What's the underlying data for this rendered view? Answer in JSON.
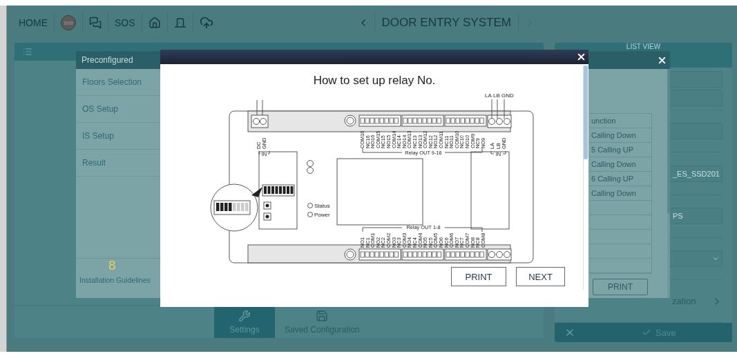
{
  "top_bar": {
    "home": "HOME",
    "emergency_badge": "999",
    "sos": "SOS",
    "title": "DOOR ENTRY SYSTEM"
  },
  "main_panel": {
    "tabs": [
      {
        "label": "Settings",
        "kind": "settings",
        "selected": true
      },
      {
        "label": "Saved Configuration",
        "kind": "saved",
        "selected": false
      }
    ]
  },
  "list_view": {
    "title": "LIST VIEW",
    "rows": [
      {
        "fields": [
          {
            "kind": "input"
          },
          {
            "kind": "input"
          }
        ]
      },
      {
        "fields": [
          {
            "kind": "input"
          }
        ]
      },
      {
        "fields": [
          {
            "kind": "input",
            "value": "_ES_SSD201"
          }
        ]
      },
      {
        "fields": [
          {
            "kind": "input",
            "value": "PS"
          }
        ]
      },
      {
        "fields": [
          {
            "kind": "select"
          }
        ]
      },
      {
        "fields": [
          {
            "kind": "link",
            "label": "zation"
          }
        ]
      }
    ],
    "save": "Save"
  },
  "preconfigured": {
    "title": "Preconfigured",
    "menu": [
      {
        "label": "Floors Selection"
      },
      {
        "label": "OS Setup"
      },
      {
        "label": "IS Setup"
      },
      {
        "label": "Result"
      }
    ],
    "guide_number": "8",
    "guide_label": "Installation Guidelines",
    "table_header": "unction",
    "table_rows": [
      "Calling Down",
      "5 Calling UP",
      "Calling Down",
      "6 Calling UP",
      "Calling Down"
    ],
    "print": "PRINT"
  },
  "relay_guide": {
    "title": "How to set up relay No.",
    "diagram": {
      "wire_labels": [
        "LA",
        "LB",
        "GND"
      ],
      "dc_labels": [
        "DC",
        "GND"
      ],
      "in_labels": [
        "IN",
        "IN"
      ],
      "bus_labels": [
        "LA",
        "LB",
        "GND"
      ],
      "top_relay_title": "Relay OUT 9-16",
      "top_pins": [
        "COM16",
        "NC16",
        "NO16",
        "COM15",
        "NC15",
        "NO15",
        "COM14",
        "NC14",
        "NO14",
        "COM13",
        "NC13",
        "NO13",
        "COM12",
        "NC12",
        "NO12",
        "COM11",
        "NC11",
        "NO11",
        "COM10",
        "NC10",
        "NO10",
        "COM9",
        "NC9",
        "NO9"
      ],
      "bottom_relay_title": "Relay OUT 1-8",
      "bottom_pins": [
        "NO1",
        "NC1",
        "COM1",
        "NO2",
        "NC2",
        "COM2",
        "NO3",
        "NC3",
        "COM3",
        "NO4",
        "NC4",
        "COM4",
        "NO5",
        "NC5",
        "COM5",
        "NO6",
        "NC6",
        "COM6",
        "NO7",
        "NC7",
        "COM7",
        "NO8",
        "NC8",
        "COM8"
      ],
      "leds": [
        "Status",
        "Power"
      ]
    },
    "buttons": [
      {
        "label": "PRINT"
      },
      {
        "label": "NEXT"
      }
    ]
  }
}
